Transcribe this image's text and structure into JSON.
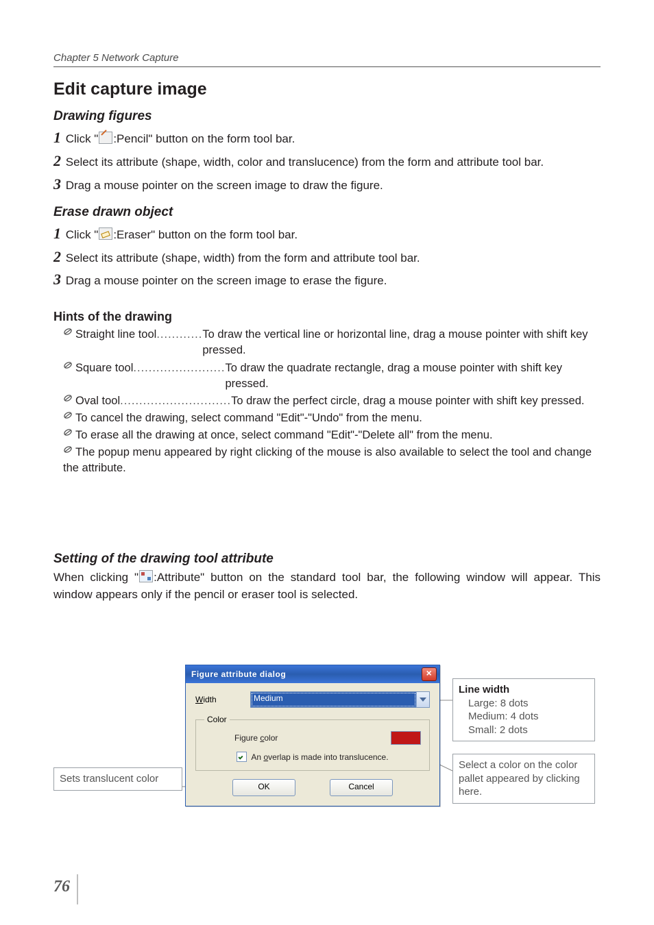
{
  "running_head": "Chapter 5 Network Capture",
  "title": "Edit capture image",
  "section_draw": {
    "heading": "Drawing figures",
    "steps": [
      {
        "n": "1",
        "pre": "Click \"",
        "icon": "pencil",
        "post": ":Pencil\" button on the form tool bar."
      },
      {
        "n": "2",
        "text": "Select its attribute (shape, width, color and translucence) from the form and attribute tool bar."
      },
      {
        "n": "3",
        "text": "Drag a mouse pointer on the screen image to draw the figure."
      }
    ]
  },
  "section_erase": {
    "heading": "Erase drawn object",
    "steps": [
      {
        "n": "1",
        "pre": "Click \"",
        "icon": "eraser",
        "post": ":Eraser\" button on the form tool bar."
      },
      {
        "n": "2",
        "text": "Select its attribute (shape, width) from the form and attribute tool bar."
      },
      {
        "n": "3",
        "text": "Drag a mouse pointer on the screen image to erase the figure."
      }
    ]
  },
  "hints": {
    "heading": "Hints of the drawing",
    "items": [
      {
        "label": "Straight line tool",
        "dots": "............",
        "desc": "To draw the vertical line or horizontal line, drag a mouse pointer with shift key pressed."
      },
      {
        "label": "Square tool",
        "dots": "........................",
        "desc": "To draw the quadrate rectangle, drag a mouse pointer with shift key pressed."
      },
      {
        "label": "Oval tool",
        "dots": ".............................",
        "desc": "To draw the perfect circle, drag a mouse pointer with shift key pressed."
      }
    ],
    "simple": [
      "To cancel the drawing, select command \"Edit\"-\"Undo\" from the menu.",
      "To erase all the drawing at once, select command \"Edit\"-\"Delete all\" from the menu.",
      "The popup menu appeared by right clicking of the mouse is also available to select the tool and change the attribute."
    ]
  },
  "section_attr": {
    "heading": "Setting of the drawing tool attribute",
    "para_pre": "When clicking \"",
    "para_post": ":Attribute\" button on the standard tool bar, the following window will appear. This window appears only if the pencil or eraser tool is selected."
  },
  "dialog": {
    "title": "Figure attribute dialog",
    "width_label": "Width",
    "width_value": "Medium",
    "color_group": "Color",
    "figure_color_label": "Figure color",
    "checkbox_label": "An overlap is made into translucence.",
    "ok": "OK",
    "cancel": "Cancel"
  },
  "callouts": {
    "left": "Sets translucent color",
    "right_top_title": "Line width",
    "right_top_lines": [
      "Large: 8 dots",
      "Medium: 4 dots",
      "Small: 2 dots"
    ],
    "right_bottom": "Select a color on the color pallet appeared by clicking here."
  },
  "page_number": "76"
}
